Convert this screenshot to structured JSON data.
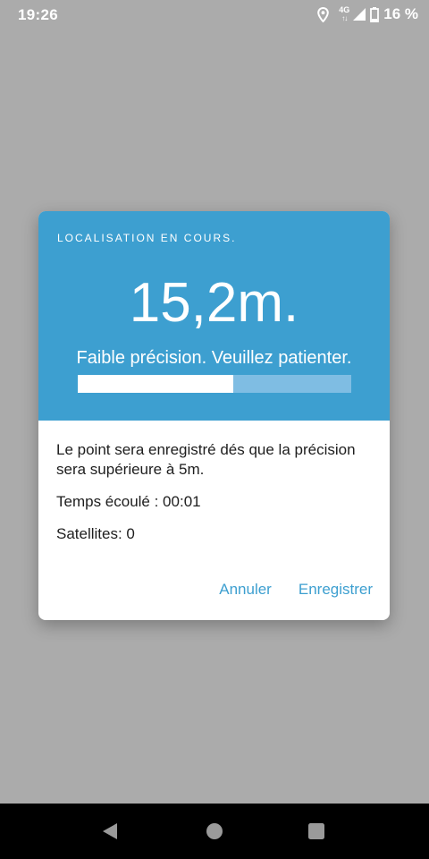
{
  "status_bar": {
    "time": "19:26",
    "network": "4G",
    "battery_percent": "16 %",
    "icons": [
      "location-icon",
      "network-arrows-icon",
      "signal-icon",
      "battery-icon"
    ]
  },
  "dialog": {
    "kicker": "LOCALISATION EN COURS.",
    "accuracy": "15,2m.",
    "precision_text": "Faible précision. Veuillez patienter.",
    "progress_fraction": 0.57,
    "message": "Le point sera enregistré dés que la précision sera supérieure à 5m.",
    "elapsed": "Temps écoulé : 00:01",
    "satellites": "Satellites: 0",
    "cancel_label": "Annuler",
    "save_label": "Enregistrer",
    "colors": {
      "header": "#3d9fd0",
      "accent": "#3d9fd0",
      "progress_track": "#7fbde3",
      "scrim": "#ababab"
    }
  },
  "nav_bar": {
    "icons": [
      "back-icon",
      "home-icon",
      "recents-icon"
    ]
  }
}
